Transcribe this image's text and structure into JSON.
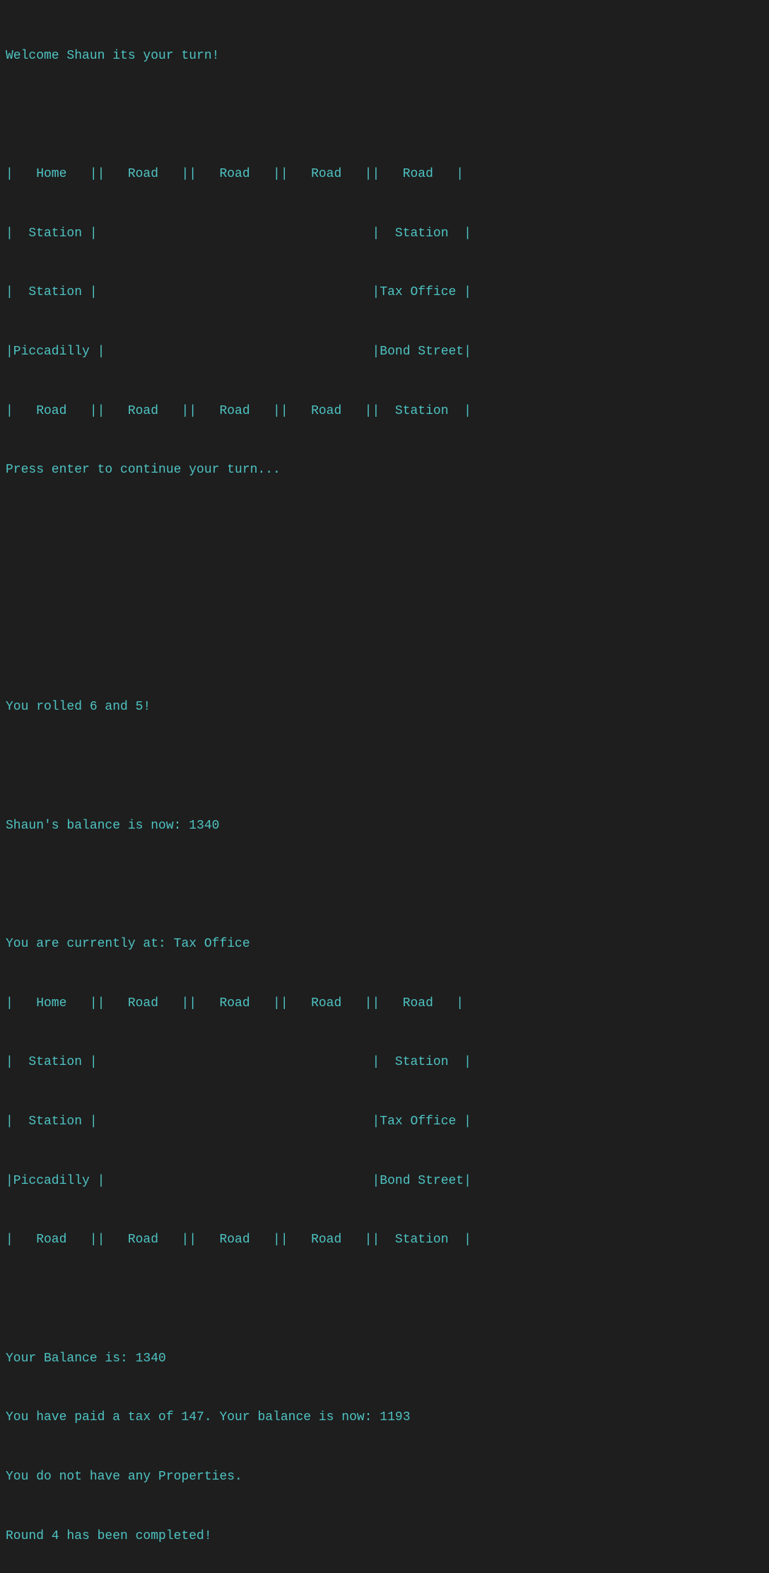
{
  "terminal": {
    "lines": [
      "Welcome Shaun its your turn!",
      "",
      "|   Home   ||   Road   ||   Road   ||   Road   ||   Road   |",
      "|  Station |                                    |  Station  |",
      "|  Station |                                    |Tax Office |",
      "|Piccadilly |                                   |Bond Street|",
      "|   Road   ||   Road   ||   Road   ||   Road   ||  Station  |",
      "Press enter to continue your turn...",
      "",
      "",
      "",
      "You rolled 6 and 5!",
      "",
      "Shaun's balance is now: 1340",
      "",
      "You are currently at: Tax Office",
      "|   Home   ||   Road   ||   Road   ||   Road   ||   Road   |",
      "|  Station |                                    |  Station  |",
      "|  Station |                                    |Tax Office |",
      "|Piccadilly |                                   |Bond Street|",
      "|   Road   ||   Road   ||   Road   ||   Road   ||  Station  |",
      "",
      "Your Balance is: 1340",
      "You have paid a tax of 147. Your balance is now: 1193",
      "You do not have any Properties.",
      "Round 4 has been completed!"
    ]
  }
}
